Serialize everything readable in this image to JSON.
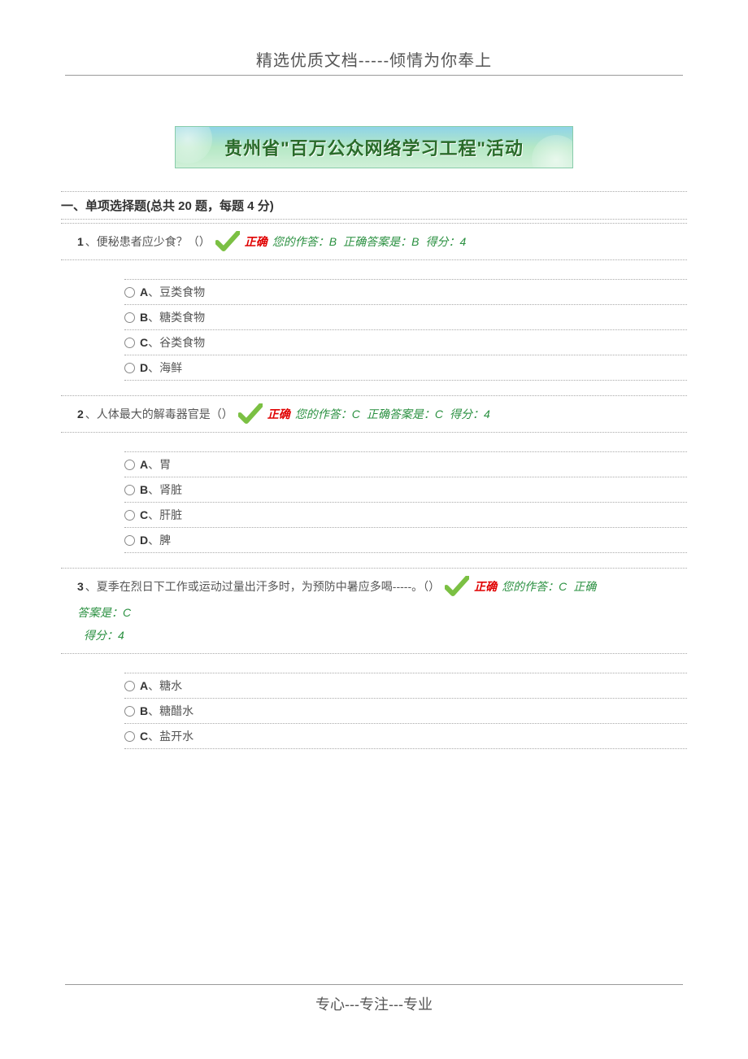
{
  "header": "精选优质文档-----倾情为你奉上",
  "banner": "贵州省\"百万公众网络学习工程\"活动",
  "section_title": "一、单项选择题(总共 20 题，每题 4 分)",
  "correct_label": "正确",
  "questions": [
    {
      "num": "1",
      "text": "、便秘患者应少食？（）",
      "your_answer": "您的作答：B",
      "correct_answer": "正确答案是：B",
      "score": "得分：4",
      "options": [
        {
          "letter": "A",
          "text": "、豆类食物"
        },
        {
          "letter": "B",
          "text": "、糖类食物"
        },
        {
          "letter": "C",
          "text": "、谷类食物"
        },
        {
          "letter": "D",
          "text": "、海鲜"
        }
      ]
    },
    {
      "num": "2",
      "text": "、人体最大的解毒器官是（）",
      "your_answer": "您的作答：C",
      "correct_answer": "正确答案是：C",
      "score": "得分：4",
      "options": [
        {
          "letter": "A",
          "text": "、胃"
        },
        {
          "letter": "B",
          "text": "、肾脏"
        },
        {
          "letter": "C",
          "text": "、肝脏"
        },
        {
          "letter": "D",
          "text": "、脾"
        }
      ]
    },
    {
      "num": "3",
      "text": "、夏季在烈日下工作或运动过量出汗多时，为预防中暑应多喝-----。（）",
      "your_answer": "您的作答：C",
      "correct_answer_prefix": "正确",
      "correct_answer": "答案是：C",
      "score": "得分：4",
      "options": [
        {
          "letter": "A",
          "text": "、糖水"
        },
        {
          "letter": "B",
          "text": "、糖醋水"
        },
        {
          "letter": "C",
          "text": "、盐开水"
        }
      ]
    }
  ],
  "footer": "专心---专注---专业"
}
